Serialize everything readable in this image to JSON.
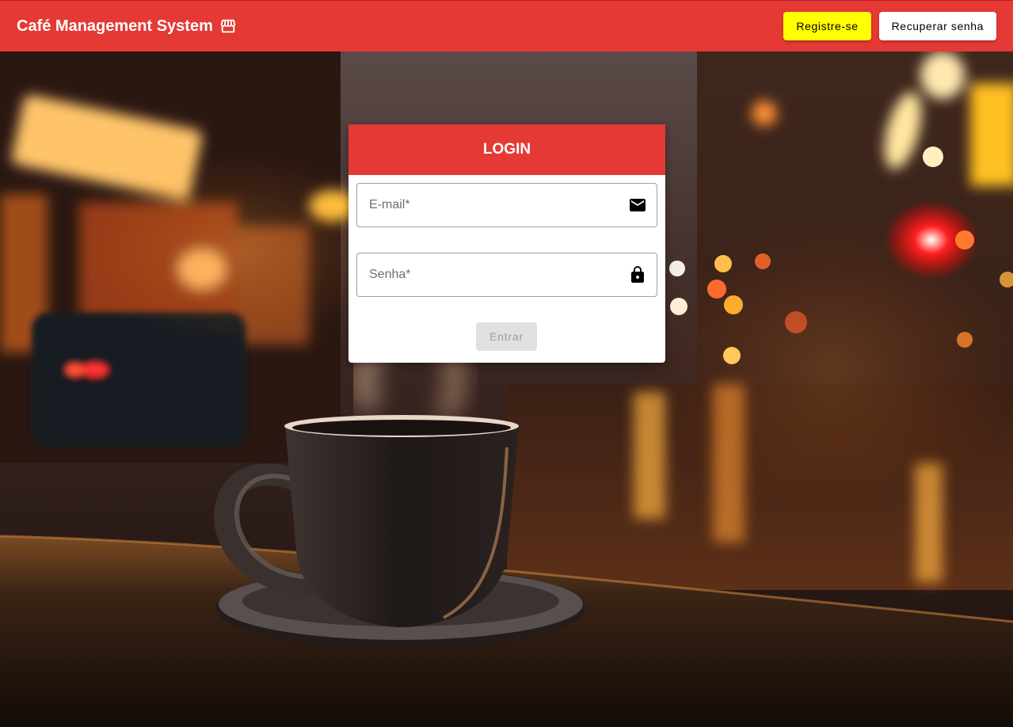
{
  "toolbar": {
    "title": "Café Management System",
    "title_icon": "storefront-icon",
    "register_label": "Registre-se",
    "recover_label": "Recuperar senha"
  },
  "login": {
    "header": "LOGIN",
    "email_placeholder": "E-mail*",
    "email_icon": "mail-icon",
    "password_placeholder": "Senha*",
    "password_icon": "lock-icon",
    "submit_label": "Entrar",
    "submit_enabled": false
  },
  "colors": {
    "primary": "#e53935",
    "register_bg": "#ffff00",
    "disabled_bg": "#e0e0e0"
  }
}
